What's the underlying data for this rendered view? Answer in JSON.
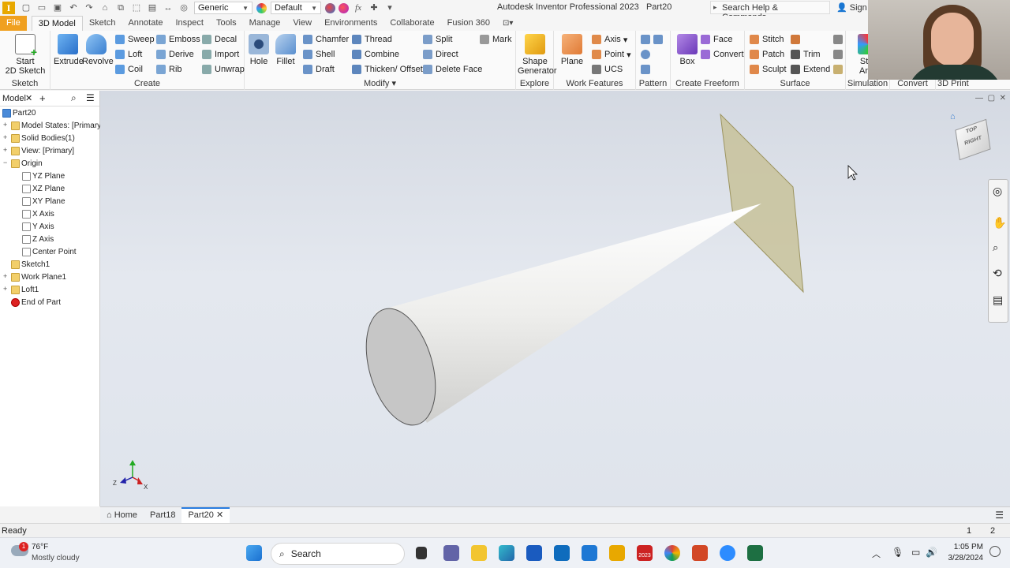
{
  "qat": {
    "appearance": "Generic",
    "material": "Default",
    "fx": "fx"
  },
  "titlebar": {
    "title": "Autodesk Inventor Professional 2023",
    "document": "Part20",
    "search_placeholder": "Search Help & Commands...",
    "sign_in": "Sign In"
  },
  "tabs": [
    "File",
    "3D Model",
    "Sketch",
    "Annotate",
    "Inspect",
    "Tools",
    "Manage",
    "View",
    "Environments",
    "Collaborate",
    "Fusion 360"
  ],
  "active_tab": "3D Model",
  "ribbon": {
    "sketch": {
      "start": "Start",
      "start2": "2D Sketch",
      "label": "Sketch"
    },
    "create": {
      "extrude": "Extrude",
      "revolve": "Revolve",
      "sweep": "Sweep",
      "loft": "Loft",
      "coil": "Coil",
      "emboss": "Emboss",
      "derive": "Derive",
      "rib": "Rib",
      "decal": "Decal",
      "import": "Import",
      "unwrap": "Unwrap",
      "label": "Create"
    },
    "modify": {
      "hole": "Hole",
      "fillet": "Fillet",
      "chamfer": "Chamfer",
      "shell": "Shell",
      "draft": "Draft",
      "thread": "Thread",
      "combine": "Combine",
      "thicken": "Thicken/ Offset",
      "split": "Split",
      "direct": "Direct",
      "delete_face": "Delete Face",
      "mark": "Mark",
      "label": "Modify"
    },
    "explore": {
      "shape": "Shape",
      "shape2": "Generator",
      "label": "Explore"
    },
    "work": {
      "plane": "Plane",
      "axis": "Axis",
      "point": "Point",
      "ucs": "UCS",
      "label": "Work Features"
    },
    "pattern": {
      "label": "Pattern"
    },
    "freeform": {
      "box": "Box",
      "face": "Face",
      "convert": "Convert",
      "label": "Create Freeform"
    },
    "surface": {
      "stitch": "Stitch",
      "patch": "Patch",
      "sculpt": "Sculpt",
      "trim": "Trim",
      "extend": "Extend",
      "label": "Surface"
    },
    "simulation": {
      "stress": "Stre",
      "stress2": "Anal",
      "label": "Simulation"
    },
    "convert": {
      "label": "Convert"
    },
    "print": {
      "label": "3D Print"
    }
  },
  "browser": {
    "title": "Model",
    "items": [
      {
        "label": "Part20",
        "indent": 0
      },
      {
        "label": "Model States: [Primary]",
        "indent": 1
      },
      {
        "label": "Solid Bodies(1)",
        "indent": 1
      },
      {
        "label": "View: [Primary]",
        "indent": 1
      },
      {
        "label": "Origin",
        "indent": 1
      },
      {
        "label": "YZ Plane",
        "indent": 2
      },
      {
        "label": "XZ Plane",
        "indent": 2
      },
      {
        "label": "XY Plane",
        "indent": 2
      },
      {
        "label": "X Axis",
        "indent": 2
      },
      {
        "label": "Y Axis",
        "indent": 2
      },
      {
        "label": "Z Axis",
        "indent": 2
      },
      {
        "label": "Center Point",
        "indent": 2
      },
      {
        "label": "Sketch1",
        "indent": 1
      },
      {
        "label": "Work Plane1",
        "indent": 1
      },
      {
        "label": "Loft1",
        "indent": 1
      },
      {
        "label": "End of Part",
        "indent": 1
      }
    ]
  },
  "viewcube": {
    "face_top": "TOP",
    "face_right": "RIGHT"
  },
  "triad": {
    "x": "X",
    "y": "Y",
    "z": "Z"
  },
  "doc_tabs": [
    "Home",
    "Part18",
    "Part20"
  ],
  "active_doc": "Part20",
  "status": {
    "text": "Ready",
    "count1": "1",
    "count2": "2"
  },
  "taskbar": {
    "weather_temp": "76°F",
    "weather_desc": "Mostly cloudy",
    "badge": "1",
    "search": "Search",
    "time": "1:05 PM",
    "date": "3/28/2024",
    "sw_label": "2023"
  },
  "colors": {
    "accent": "#f0a020",
    "tab_active": "#2a7de1",
    "viewport_top": "#d4d9e2",
    "plane_fill": "#c8c29a"
  }
}
